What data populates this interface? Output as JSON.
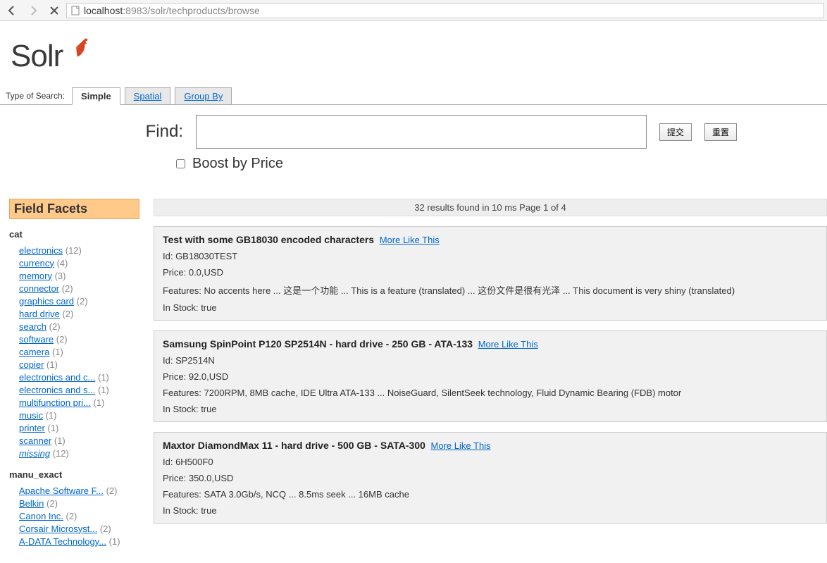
{
  "browser": {
    "url_host": "localhost",
    "url_port": ":8983",
    "url_path": "/solr/techproducts/browse"
  },
  "logo": {
    "text": "Solr"
  },
  "tabs": {
    "label": "Type of Search:",
    "items": [
      {
        "label": "Simple",
        "active": true
      },
      {
        "label": "Spatial",
        "active": false
      },
      {
        "label": "Group By",
        "active": false
      }
    ]
  },
  "search": {
    "find_label": "Find:",
    "query": "",
    "submit_label": "提交",
    "reset_label": "重置",
    "boost_label": "Boost by Price"
  },
  "results_summary": "32 results found in 10 ms Page 1 of 4",
  "facets": {
    "header": "Field Facets",
    "groups": [
      {
        "name": "cat",
        "items": [
          {
            "label": "electronics",
            "count": 12
          },
          {
            "label": "currency",
            "count": 4
          },
          {
            "label": "memory",
            "count": 3
          },
          {
            "label": "connector",
            "count": 2
          },
          {
            "label": "graphics card",
            "count": 2
          },
          {
            "label": "hard drive",
            "count": 2
          },
          {
            "label": "search",
            "count": 2
          },
          {
            "label": "software",
            "count": 2
          },
          {
            "label": "camera",
            "count": 1
          },
          {
            "label": "copier",
            "count": 1
          },
          {
            "label": "electronics and c...",
            "count": 1
          },
          {
            "label": "electronics and s...",
            "count": 1
          },
          {
            "label": "multifunction pri...",
            "count": 1
          },
          {
            "label": "music",
            "count": 1
          },
          {
            "label": "printer",
            "count": 1
          },
          {
            "label": "scanner",
            "count": 1
          },
          {
            "label": "missing",
            "count": 12,
            "italic": true
          }
        ]
      },
      {
        "name": "manu_exact",
        "items": [
          {
            "label": "Apache Software F...",
            "count": 2
          },
          {
            "label": "Belkin",
            "count": 2
          },
          {
            "label": "Canon Inc.",
            "count": 2
          },
          {
            "label": "Corsair Microsyst...",
            "count": 2
          },
          {
            "label": "A-DATA Technology...",
            "count": 1
          }
        ]
      }
    ]
  },
  "more_like_this_label": "More Like This",
  "results": [
    {
      "title": "Test with some GB18030 encoded characters",
      "id_line": "Id: GB18030TEST",
      "price_line": "Price: 0.0,USD",
      "features_line": "Features: No accents here ... 这是一个功能 ... This is a feature (translated) ... 这份文件是很有光泽 ... This document is very shiny (translated)",
      "stock_line": "In Stock: true"
    },
    {
      "title": "Samsung SpinPoint P120 SP2514N - hard drive - 250 GB - ATA-133",
      "id_line": "Id: SP2514N",
      "price_line": "Price: 92.0,USD",
      "features_line": "Features: 7200RPM, 8MB cache, IDE Ultra ATA-133 ... NoiseGuard, SilentSeek technology, Fluid Dynamic Bearing (FDB) motor",
      "stock_line": "In Stock: true"
    },
    {
      "title": "Maxtor DiamondMax 11 - hard drive - 500 GB - SATA-300",
      "id_line": "Id: 6H500F0",
      "price_line": "Price: 350.0,USD",
      "features_line": "Features: SATA 3.0Gb/s, NCQ ... 8.5ms seek ... 16MB cache",
      "stock_line": "In Stock: true"
    }
  ]
}
